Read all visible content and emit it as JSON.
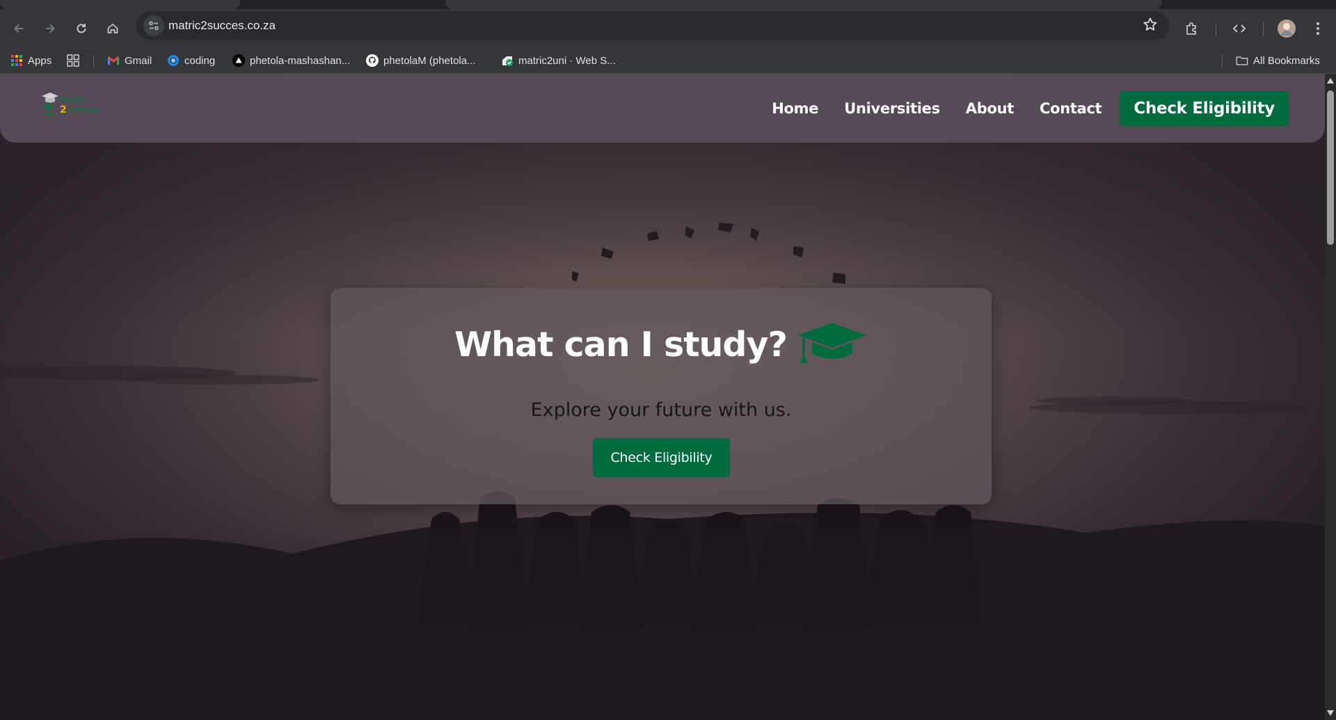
{
  "browser": {
    "url": "matric2succes.co.za",
    "bookmarks": [
      {
        "label": "Apps",
        "icon": "apps-grid-icon"
      },
      {
        "label": "",
        "icon": "tab-groups-icon"
      },
      {
        "label": "Gmail",
        "icon": "gmail-icon"
      },
      {
        "label": "coding",
        "icon": "coding-icon"
      },
      {
        "label": "phetola-mashashan...",
        "icon": "vercel-icon"
      },
      {
        "label": "phetolaM (phetola...",
        "icon": "github-icon"
      },
      {
        "label": "matric2uni · Web S...",
        "icon": "web-service-icon"
      }
    ],
    "all_bookmarks": "All Bookmarks"
  },
  "site": {
    "logo": {
      "word1": "Matric",
      "num": "2",
      "word2": "Success"
    },
    "nav": [
      "Home",
      "Universities",
      "About",
      "Contact"
    ],
    "nav_cta": "Check Eligibility",
    "hero": {
      "title": "What can I study?",
      "subtitle": "Explore your future with us.",
      "button": "Check Eligibility"
    }
  },
  "colors": {
    "brand_green": "#006b3f",
    "header_bg": "#584e5a",
    "chrome_bg": "#35363a"
  }
}
